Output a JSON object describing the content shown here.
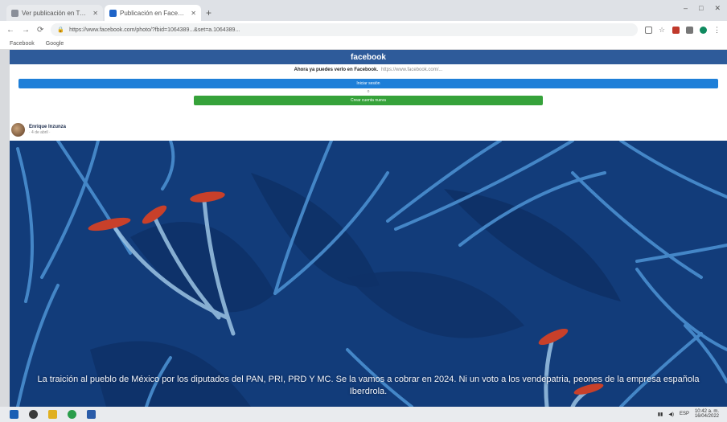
{
  "browser": {
    "tabs": [
      {
        "label": "Ver publicación en Twitter / X",
        "active": false
      },
      {
        "label": "Publicación en Facebook",
        "active": true
      }
    ],
    "new_tab_glyph": "+",
    "window_controls": [
      "–",
      "□",
      "✕"
    ],
    "nav_icons": [
      "←",
      "→",
      "⟳"
    ],
    "url": "https://www.facebook.com/photo/?fbid=1064389...&set=a.1064389...",
    "bookmarks": [
      "Facebook",
      "Google"
    ]
  },
  "page": {
    "header_title": "facebook",
    "notice_bold": "Ahora ya puedes verlo en Facebook.",
    "notice_link": "https://www.facebook.com/...",
    "login_button": "Iniciar sesión",
    "or_text": "o",
    "create_button": "Crear cuenta nueva"
  },
  "post": {
    "author": "Enrique Inzunza",
    "meta": "· 4 de abril ·",
    "caption": "La traición al pueblo de México por los diputados del PAN, PRI, PRD Y MC. Se la vamos a cobrar en 2024. Ni un voto a los vendepatria, peones de la empresa española Iberdrola."
  },
  "taskbar": {
    "icons": [
      "start-icon",
      "search-icon",
      "file-explorer-icon",
      "chrome-icon",
      "word-icon"
    ],
    "icon_colors": [
      "#1a5fb4",
      "#3a3a3a",
      "#e0b020",
      "#2a9d4a",
      "#2b5ca8"
    ],
    "tray_time": "10:42 a. m.",
    "tray_date": "16/04/2022"
  },
  "colors": {
    "facebook_blue": "#2e5b9a",
    "login_blue": "#1e7fd8",
    "create_green": "#36a23a",
    "art_background": "#123c7a",
    "stamen_red": "#c8402a"
  }
}
